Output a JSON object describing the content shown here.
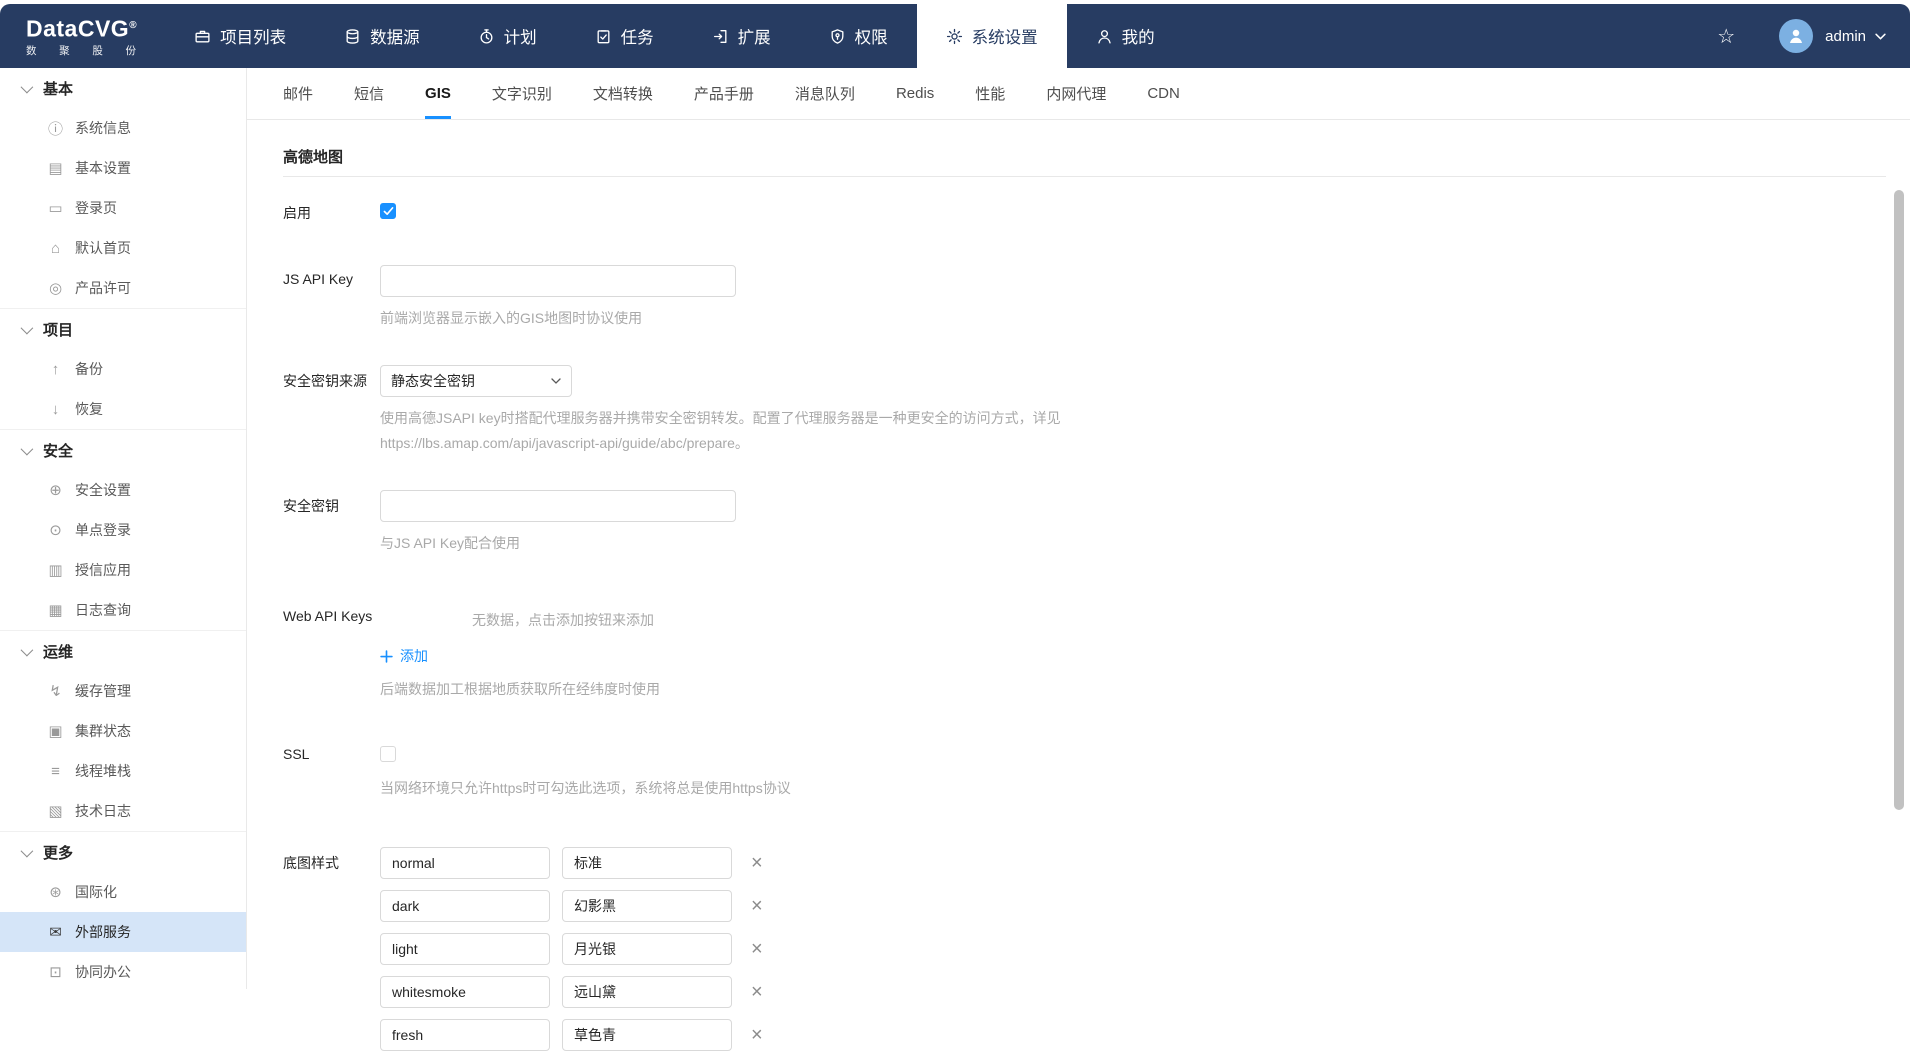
{
  "brand": {
    "name": "DataCVG",
    "reg": "®",
    "subtext": "数聚股份"
  },
  "navbar": {
    "items": [
      {
        "id": "project-list",
        "label": "项目列表",
        "icon": "briefcase-icon"
      },
      {
        "id": "data-source",
        "label": "数据源",
        "icon": "database-icon"
      },
      {
        "id": "plan",
        "label": "计划",
        "icon": "stopwatch-icon"
      },
      {
        "id": "tasks",
        "label": "任务",
        "icon": "clipboard-check-icon"
      },
      {
        "id": "extension",
        "label": "扩展",
        "icon": "extension-icon"
      },
      {
        "id": "permission",
        "label": "权限",
        "icon": "shield-key-icon"
      },
      {
        "id": "system-settings",
        "label": "系统设置",
        "icon": "gear-icon",
        "active": true
      },
      {
        "id": "mine",
        "label": "我的",
        "icon": "user-icon"
      }
    ],
    "star_icon": "☆",
    "user": {
      "name": "admin"
    }
  },
  "sidebar": {
    "sections": [
      {
        "title": "基本",
        "items": [
          {
            "id": "system-info",
            "label": "系统信息",
            "icon": "info-icon"
          },
          {
            "id": "basic-settings",
            "label": "基本设置",
            "icon": "doc-gear-icon"
          },
          {
            "id": "login-page",
            "label": "登录页",
            "icon": "monitor-icon"
          },
          {
            "id": "default-home",
            "label": "默认首页",
            "icon": "home-icon"
          },
          {
            "id": "product-license",
            "label": "产品许可",
            "icon": "license-icon"
          }
        ]
      },
      {
        "title": "项目",
        "items": [
          {
            "id": "backup",
            "label": "备份",
            "icon": "doc-up-icon"
          },
          {
            "id": "restore",
            "label": "恢复",
            "icon": "doc-down-icon"
          }
        ]
      },
      {
        "title": "安全",
        "items": [
          {
            "id": "security-settings",
            "label": "安全设置",
            "icon": "shield-plus-icon"
          },
          {
            "id": "sso",
            "label": "单点登录",
            "icon": "chat-bubbles-icon"
          },
          {
            "id": "trusted-apps",
            "label": "授信应用",
            "icon": "doc-ribbon-icon"
          },
          {
            "id": "log-query",
            "label": "日志查询",
            "icon": "doc-search-icon"
          }
        ]
      },
      {
        "title": "运维",
        "items": [
          {
            "id": "cache-management",
            "label": "缓存管理",
            "icon": "bolt-circle-icon"
          },
          {
            "id": "cluster-status",
            "label": "集群状态",
            "icon": "cluster-icon"
          },
          {
            "id": "thread-stack",
            "label": "线程堆栈",
            "icon": "stack-window-icon"
          },
          {
            "id": "tech-log",
            "label": "技术日志",
            "icon": "terminal-icon"
          }
        ]
      },
      {
        "title": "更多",
        "items": [
          {
            "id": "i18n",
            "label": "国际化",
            "icon": "globe-icon"
          },
          {
            "id": "external-services",
            "label": "外部服务",
            "icon": "mail-gear-icon",
            "active": true
          },
          {
            "id": "office",
            "label": "协同办公",
            "icon": "chat-icon"
          }
        ]
      }
    ]
  },
  "tabs": {
    "active": "gis",
    "items": [
      {
        "id": "mail",
        "label": "邮件"
      },
      {
        "id": "sms",
        "label": "短信"
      },
      {
        "id": "gis",
        "label": "GIS"
      },
      {
        "id": "ocr",
        "label": "文字识别"
      },
      {
        "id": "doc-convert",
        "label": "文档转换"
      },
      {
        "id": "product-manual",
        "label": "产品手册"
      },
      {
        "id": "message-queue",
        "label": "消息队列"
      },
      {
        "id": "redis",
        "label": "Redis"
      },
      {
        "id": "performance",
        "label": "性能"
      },
      {
        "id": "intranet-proxy",
        "label": "内网代理"
      },
      {
        "id": "cdn",
        "label": "CDN"
      }
    ]
  },
  "content": {
    "section_title": "高德地图",
    "fields": {
      "enable": {
        "label": "启用",
        "checked": true
      },
      "js_api_key": {
        "label": "JS API Key",
        "value": "",
        "hint": "前端浏览器显示嵌入的GIS地图时协议使用"
      },
      "key_source": {
        "label": "安全密钥来源",
        "value": "静态安全密钥",
        "hint": "使用高德JSAPI key时搭配代理服务器并携带安全密钥转发。配置了代理服务器是一种更安全的访问方式，详见 https://lbs.amap.com/api/javascript-api/guide/abc/prepare。"
      },
      "secret": {
        "label": "安全密钥",
        "value": "",
        "hint": "与JS API Key配合使用"
      },
      "web_api_keys": {
        "label": "Web API Keys",
        "empty_text": "无数据，点击添加按钮来添加",
        "add_label": "添加",
        "hint": "后端数据加工根据地质获取所在经纬度时使用"
      },
      "ssl": {
        "label": "SSL",
        "checked": false,
        "hint": "当网络环境只允许https时可勾选此选项，系统将总是使用https协议"
      },
      "basemap": {
        "label": "底图样式",
        "rows": [
          {
            "key": "normal",
            "name": "标准"
          },
          {
            "key": "dark",
            "name": "幻影黑"
          },
          {
            "key": "light",
            "name": "月光银"
          },
          {
            "key": "whitesmoke",
            "name": "远山黛"
          },
          {
            "key": "fresh",
            "name": "草色青"
          }
        ]
      }
    }
  },
  "colors": {
    "navbar": "#273c62",
    "accent": "#1890ff",
    "selected_item_bg": "#d5e5f8"
  }
}
